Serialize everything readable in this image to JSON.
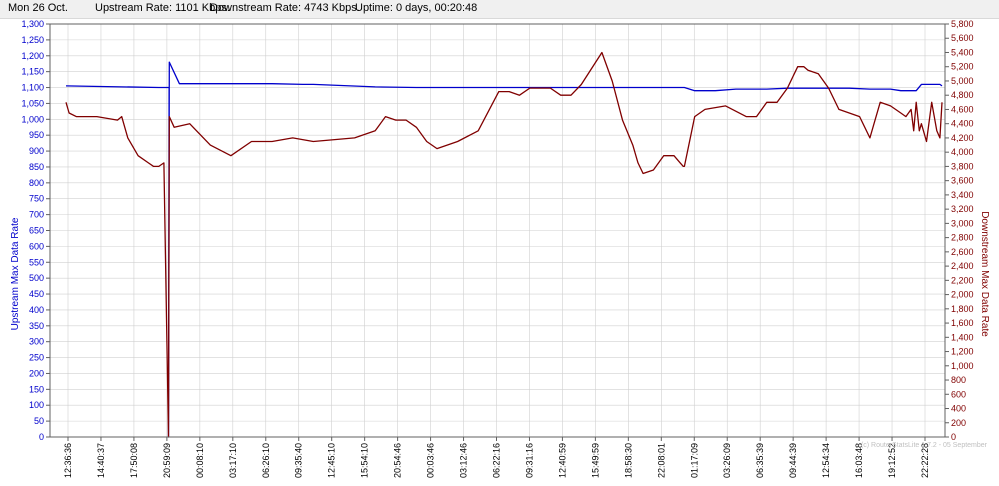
{
  "header": {
    "date": "Mon 26 Oct.",
    "upstream": "Upstream Rate: 1101 Kbps.",
    "downstream": "Downstream Rate: 4743 Kbps.",
    "uptime": "Uptime: 0 days, 00:20:48"
  },
  "watermark": "(c) RouterStatsLite 1.7.2 - 05 September",
  "colors": {
    "upstream": "#0000cc",
    "downstream": "#800000",
    "grid": "#d0d0d0"
  },
  "chart_data": {
    "type": "line",
    "title": "",
    "xlabel": "",
    "ylabel_left": "Upstream Max Data Rate",
    "ylabel_right": "Downstream Max Data Rate",
    "ylim_left": [
      0,
      1300
    ],
    "ylim_right": [
      0,
      5800
    ],
    "yticks_left": [
      "0",
      "50",
      "100",
      "150",
      "200",
      "250",
      "300",
      "350",
      "400",
      "450",
      "500",
      "550",
      "600",
      "650",
      "700",
      "750",
      "800",
      "850",
      "900",
      "950",
      "1,000",
      "1,050",
      "1,100",
      "1,150",
      "1,200",
      "1,250",
      "1,300"
    ],
    "yticks_right": [
      "0",
      "200",
      "400",
      "600",
      "800",
      "1,000",
      "1,200",
      "1,400",
      "1,600",
      "1,800",
      "2,000",
      "2,200",
      "2,400",
      "2,600",
      "2,800",
      "3,000",
      "3,200",
      "3,400",
      "3,600",
      "3,800",
      "4,000",
      "4,200",
      "4,400",
      "4,600",
      "4,800",
      "5,000",
      "5,200",
      "5,400",
      "5,600",
      "5,800"
    ],
    "xticks": [
      "12:36:36",
      "14:40:37",
      "17:50:08",
      "20:59:09",
      "00:08:10",
      "03:17:10",
      "06:26:10",
      "09:35:40",
      "12:45:10",
      "15:54:10",
      "20:54:46",
      "00:03:46",
      "03:12:46",
      "06:22:16",
      "09:31:16",
      "12:40:59",
      "15:49:59",
      "18:58:30",
      "22:08:01",
      "01:17:09",
      "03:26:09",
      "06:35:39",
      "09:44:39",
      "12:54:34",
      "16:03:48",
      "19:12:52",
      "22:22:28"
    ],
    "grid": true,
    "series": [
      {
        "name": "Upstream Max Data Rate",
        "axis": "left",
        "x": [
          0,
          9,
          10,
          9.95,
          10.02,
          11,
          12,
          20,
          23,
          24,
          30,
          34,
          35,
          38,
          41,
          45,
          50,
          56,
          59,
          59.6,
          60,
          61,
          63,
          65,
          68,
          70,
          73,
          73.6,
          74,
          74.6,
          75,
          76,
          78,
          79,
          80,
          81,
          82,
          82.25,
          82.5,
          83,
          84,
          84.4,
          84.8,
          85
        ],
        "y": [
          1105,
          1100,
          1100,
          0,
          1180,
          1112,
          1112,
          1112,
          1110,
          1110,
          1102,
          1100,
          1100,
          1100,
          1100,
          1100,
          1100,
          1100,
          1100,
          1100,
          1100,
          1090,
          1090,
          1095,
          1095,
          1098,
          1098,
          1098,
          1098,
          1098,
          1098,
          1098,
          1095,
          1095,
          1095,
          1090,
          1090,
          1090,
          1090,
          1110,
          1110,
          1110,
          1110,
          1105
        ]
      },
      {
        "name": "Downstream Max Data Rate",
        "axis": "right",
        "x": [
          0,
          0.3,
          1,
          3,
          5,
          5.4,
          6,
          7,
          8,
          8.5,
          9,
          9.5,
          9.95,
          10.02,
          10.5,
          12,
          14,
          16,
          18,
          20,
          22,
          24,
          28,
          30,
          31,
          32,
          33,
          34,
          35,
          36,
          38,
          40,
          42,
          43,
          44,
          45,
          46,
          47,
          48,
          49,
          50,
          52,
          53,
          54,
          55,
          55.5,
          56,
          57,
          58,
          59,
          59.6,
          59.9,
          60,
          61,
          62,
          64,
          66,
          67,
          68,
          69,
          70,
          71,
          71.3,
          71.6,
          72,
          73,
          74,
          75,
          77,
          78,
          79,
          80,
          81,
          81.5,
          82,
          82.25,
          82.5,
          82.8,
          83,
          83.5,
          84,
          84.5,
          84.8,
          85
        ],
        "y": [
          4700,
          4550,
          4500,
          4500,
          4450,
          4500,
          4200,
          3950,
          3850,
          3800,
          3800,
          3850,
          0,
          4500,
          4350,
          4400,
          4100,
          3950,
          4150,
          4150,
          4200,
          4150,
          4200,
          4300,
          4500,
          4450,
          4450,
          4350,
          4150,
          4050,
          4150,
          4300,
          4850,
          4850,
          4800,
          4900,
          4900,
          4900,
          4800,
          4800,
          4950,
          5400,
          5000,
          4450,
          4100,
          3850,
          3700,
          3750,
          3950,
          3950,
          3850,
          3800,
          3800,
          4500,
          4600,
          4650,
          4500,
          4500,
          4700,
          4700,
          4900,
          5200,
          5200,
          5200,
          5150,
          5100,
          4900,
          4600,
          4500,
          4200,
          4700,
          4650,
          4550,
          4500,
          4600,
          4300,
          4700,
          4300,
          4400,
          4150,
          4700,
          4300,
          4200,
          4700
        ]
      }
    ]
  }
}
